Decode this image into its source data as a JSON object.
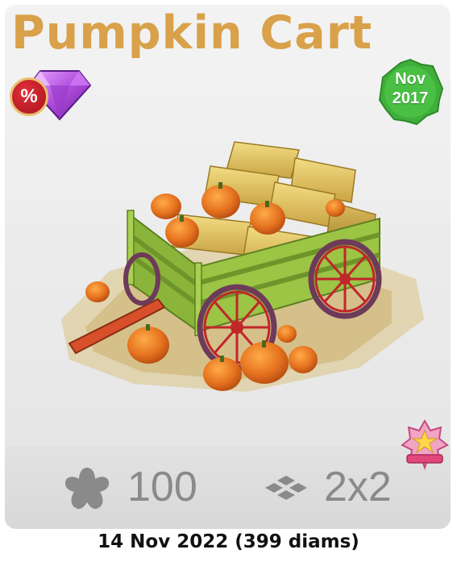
{
  "title": "Pumpkin Cart",
  "discount_badge": {
    "symbol": "%",
    "icon": "diamond-icon"
  },
  "date_badge": {
    "month": "Nov",
    "year": "2017"
  },
  "stats": {
    "reward_icon": "flower-star-icon",
    "reward_value": "100",
    "size_icon": "tiles-icon",
    "size_value": "2x2"
  },
  "event_badge_icon": "ribbon-star-icon",
  "footer": "14 Nov 2022 (399 diams)",
  "colors": {
    "title": "#d9a14a",
    "date_badge_green": "#3fae3a",
    "stat_text": "#8a8a8a",
    "discount_red": "#c8202a",
    "gem_purple": "#b04ddd"
  }
}
